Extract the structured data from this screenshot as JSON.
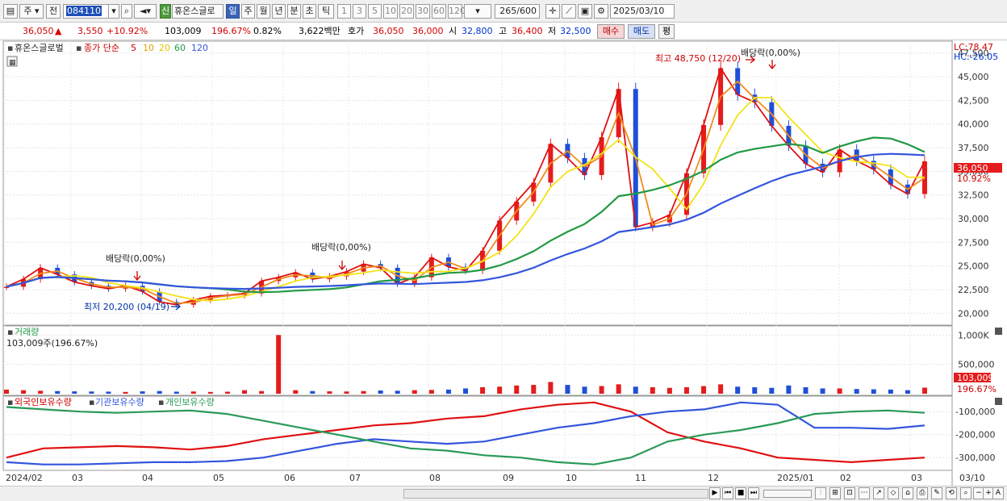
{
  "toolbar": {
    "market_label": "주",
    "prev_label": "전",
    "code": "084110",
    "new_badge": "신",
    "stock_name": "휴온스글로",
    "periods": [
      "일",
      "주",
      "월",
      "년",
      "분",
      "초",
      "틱"
    ],
    "active_period": "일",
    "numbers": [
      "1",
      "3",
      "5",
      "10",
      "20",
      "30",
      "60",
      "120"
    ],
    "count": "265",
    "count_max": "/600",
    "date": "2025/03/10"
  },
  "quote": {
    "price": "36,050",
    "change": "3,550",
    "change_pct": "+10.92%",
    "volume": "103,009",
    "volume_ratio": "196.67%",
    "turnover_pct": "0.82%",
    "amount": "3,622백만",
    "bid_label": "호가",
    "bid": "36,050",
    "ask": "36,000",
    "open_label": "시",
    "open": "32,800",
    "high_label": "고",
    "high": "36,400",
    "low_label": "저",
    "low": "32,500",
    "buy_label": "매수",
    "sell_label": "매도",
    "eval_label": "평"
  },
  "price_panel": {
    "stock_label": "휴온스글로벌",
    "ma_label": "종가 단순",
    "ma_periods": [
      "5",
      "10",
      "20",
      "60",
      "120"
    ],
    "lc": "LC:78.47",
    "hc": "HC:-26.05",
    "current_price_tag": "36,050",
    "current_pct_tag": "10.92%",
    "high_annotation": "최고 48,750 (12/20)",
    "low_annotation": "최저 20,200 (04/19)",
    "dividend_label": "배당락(0,00%)"
  },
  "volume_panel": {
    "title": "거래량",
    "readout": "103,009주(196.67%)",
    "tag_value": "103,009",
    "tag_pct": "196.67%"
  },
  "holding_panel": {
    "series_names": [
      "외국인보유수량",
      "기관보유수량",
      "개인보유수량"
    ]
  },
  "chart_data": [
    {
      "type": "candlestick",
      "series": [
        {
          "name": "5",
          "color": "#e01010"
        },
        {
          "name": "10",
          "color": "#f08c1c"
        },
        {
          "name": "20",
          "color": "#f2e318"
        },
        {
          "name": "60",
          "color": "#229944"
        },
        {
          "name": "120",
          "color": "#3355dd"
        }
      ],
      "x": [
        "2024/02",
        "03",
        "04",
        "05",
        "06",
        "07",
        "08",
        "09",
        "10",
        "11",
        "12",
        "2025/01",
        "02",
        "03",
        "03/10"
      ],
      "close": [
        22.8,
        23.6,
        24.8,
        24.1,
        23.3,
        22.9,
        22.6,
        22.9,
        22.3,
        21.2,
        20.9,
        21.4,
        21.8,
        21.9,
        22.1,
        23.4,
        23.8,
        24.3,
        23.6,
        23.9,
        24.4,
        25.2,
        24.8,
        23.1,
        23.8,
        25.9,
        24.9,
        24.5,
        26.6,
        29.8,
        31.8,
        33.8,
        37.9,
        36.4,
        34.6,
        38.6,
        43.7,
        29.1,
        29.6,
        30.4,
        34.8,
        39.9,
        45.9,
        43.1,
        42.3,
        39.8,
        37.7,
        35.8,
        34.9,
        37.3,
        36.1,
        35.2,
        33.6,
        32.6,
        36.05
      ],
      "axis": {
        "ylim": [
          19000,
          48500
        ],
        "ticks": [
          "20,000",
          "22,500",
          "25,000",
          "27,500",
          "30,000",
          "32,500",
          "35,000",
          "37,500",
          "40,000",
          "42,500",
          "45,000",
          "47,500"
        ]
      }
    },
    {
      "type": "bar",
      "title": "거래량",
      "values": [
        70,
        60,
        50,
        45,
        40,
        38,
        35,
        30,
        40,
        45,
        35,
        38,
        30,
        34,
        60,
        45,
        1000,
        60,
        45,
        40,
        38,
        45,
        55,
        50,
        60,
        65,
        70,
        90,
        110,
        120,
        140,
        150,
        200,
        150,
        120,
        130,
        160,
        120,
        110,
        100,
        110,
        130,
        160,
        120,
        110,
        100,
        140,
        110,
        90,
        90,
        80,
        75,
        70,
        60,
        103
      ],
      "axis": {
        "ticks": [
          "1,000K",
          "500,000"
        ]
      }
    },
    {
      "type": "line",
      "series": [
        {
          "name": "외국인보유수량",
          "color": "#e01010",
          "values": [
            -300000,
            -260000,
            -255000,
            -250000,
            -255000,
            -265000,
            -250000,
            -220000,
            -200000,
            -180000,
            -160000,
            -150000,
            -130000,
            -120000,
            -90000,
            -70000,
            -60000,
            -100000,
            -190000,
            -230000,
            -260000,
            -300000,
            -310000,
            -320000,
            -310000,
            -300000
          ]
        },
        {
          "name": "기관보유수량",
          "color": "#3355dd",
          "values": [
            -320000,
            -330000,
            -330000,
            -325000,
            -320000,
            -320000,
            -315000,
            -300000,
            -270000,
            -240000,
            -220000,
            -230000,
            -240000,
            -230000,
            -200000,
            -170000,
            -150000,
            -120000,
            -100000,
            -90000,
            -60000,
            -70000,
            -170000,
            -170000,
            -175000,
            -160000
          ]
        },
        {
          "name": "개인보유수량",
          "color": "#2a9958",
          "values": [
            -80000,
            -90000,
            -100000,
            -105000,
            -100000,
            -95000,
            -110000,
            -140000,
            -170000,
            -200000,
            -230000,
            -260000,
            -270000,
            -290000,
            -300000,
            -320000,
            -330000,
            -300000,
            -230000,
            -200000,
            -180000,
            -150000,
            -110000,
            -100000,
            -95000,
            -105000
          ]
        }
      ],
      "axis": {
        "ticks": [
          "-100,000",
          "-200,000",
          "-300,000"
        ]
      }
    }
  ],
  "x_labels": [
    "2024/02",
    "03",
    "04",
    "05",
    "06",
    "07",
    "08",
    "09",
    "10",
    "11",
    "12",
    "2025/01",
    "02",
    "03",
    "03/10"
  ]
}
